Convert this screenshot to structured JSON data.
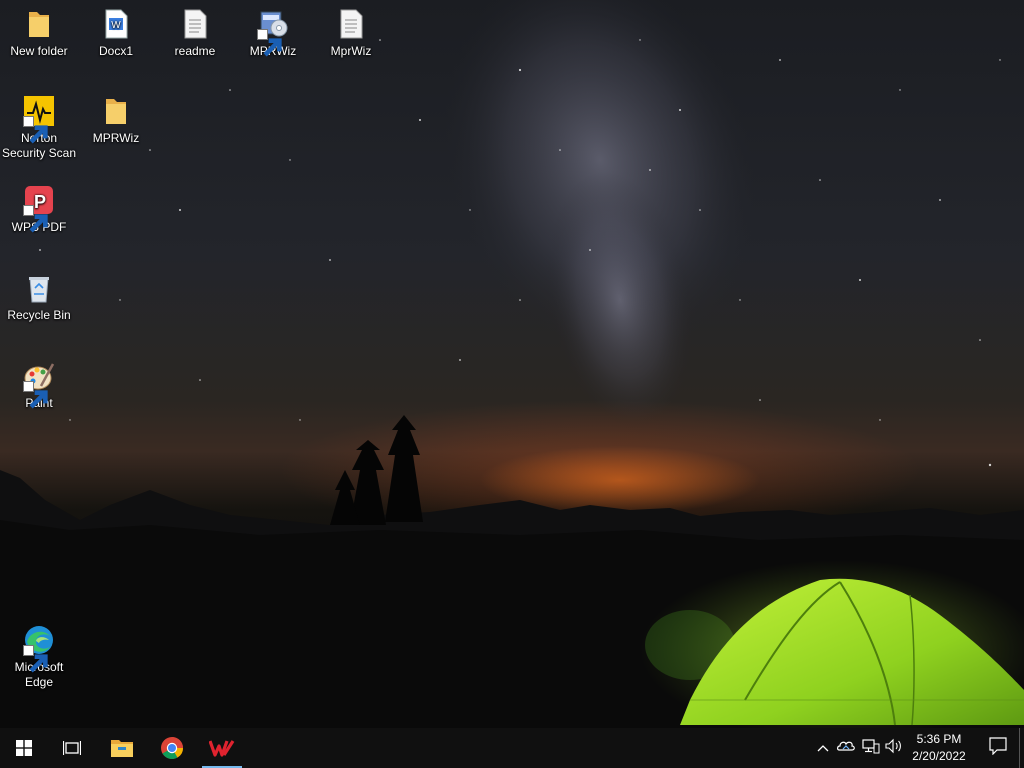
{
  "desktop": {
    "icons": [
      {
        "label": "New folder",
        "icon": "folder-icon"
      },
      {
        "label": "Docx1",
        "icon": "word-document-icon"
      },
      {
        "label": "readme",
        "icon": "text-file-icon"
      },
      {
        "label": "MPRWiz",
        "icon": "mprwiz-installer-icon"
      },
      {
        "label": "MprWiz",
        "icon": "text-file-icon"
      },
      {
        "label": "Norton Security Scan",
        "icon": "norton-icon"
      },
      {
        "label": "MPRWiz",
        "icon": "folder-icon"
      },
      {
        "label": "WPS PDF",
        "icon": "wps-pdf-icon"
      },
      {
        "label": "Recycle Bin",
        "icon": "recycle-bin-icon"
      },
      {
        "label": "Paint",
        "icon": "paint-icon"
      },
      {
        "label": "Microsoft Edge",
        "icon": "edge-icon"
      }
    ]
  },
  "taskbar": {
    "start": "start-icon",
    "task_view": "task-view-icon",
    "pinned": [
      {
        "name": "File Explorer",
        "icon": "file-explorer-icon"
      },
      {
        "name": "Google Chrome",
        "icon": "chrome-icon"
      },
      {
        "name": "WPS Office",
        "icon": "wps-office-icon",
        "active": true
      }
    ],
    "tray": {
      "icons": [
        "chevron-up-icon",
        "onedrive-icon",
        "network-icon",
        "volume-icon"
      ],
      "time": "5:36 PM",
      "date": "2/20/2022"
    },
    "notifications": "action-center-icon"
  },
  "colors": {
    "taskbar_bg": "#101010",
    "active_indicator": "#76b9ed",
    "tent_green": "#9be22a"
  }
}
